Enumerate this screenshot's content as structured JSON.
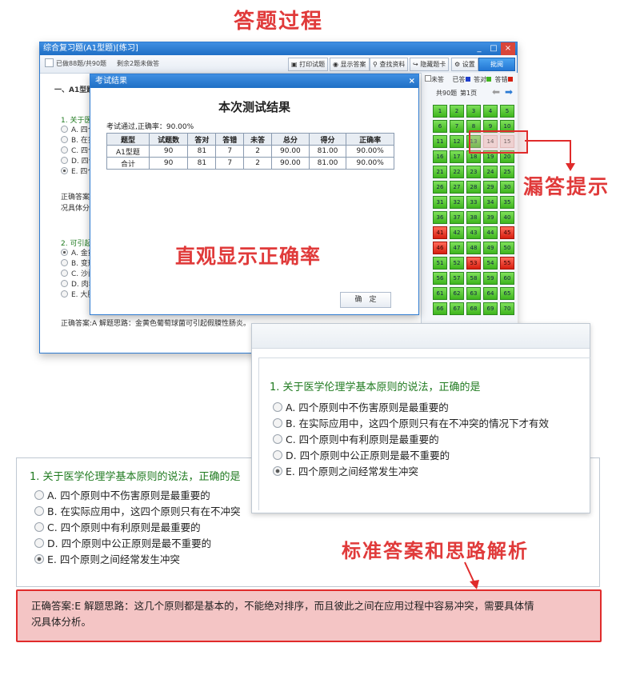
{
  "banners": {
    "top": "答题过程",
    "missed": "漏答提示",
    "accuracy": "直观显示正确率",
    "explanation": "标准答案和思路解析"
  },
  "window": {
    "title": "综合复习题(A1型题)[练习]",
    "controls": [
      "_",
      "□",
      "×"
    ],
    "status_done": "已做88题/共90题",
    "status_left": "剩余2题未做答",
    "toolbar": {
      "print": "打印试题",
      "show_answer": "显示答案",
      "lookup": "查找资料",
      "hide_card": "隐藏题卡",
      "settings": "设置",
      "submit": "批阅"
    }
  },
  "question_pane": {
    "section": "一、A1型题",
    "q1_prefix": "1. 关于医",
    "q1_opts": [
      "A. 四个",
      "B. 在实",
      "C. 四个",
      "D. 四个",
      "E. 四个"
    ],
    "q1_answer_prefix": "正确答案:E",
    "q1_analysis_prefix": "况具体分析",
    "q2_prefix": "2. 可引起",
    "q2_opts": [
      "A. 金黄",
      "B. 变形",
      "C. 沙门",
      "D. 肉毒",
      "E. 大肠"
    ],
    "q2_answer": "正确答案:A   解题思路：金黄色葡萄球菌可引起假膜性肠炎。"
  },
  "side_panel": {
    "legend": [
      "未答",
      "已答",
      "答对",
      "答错"
    ],
    "legend_colors": [
      "#ffffff",
      "#1f3fcc",
      "#3fb51e",
      "#d61f10"
    ],
    "total": "共90题",
    "page": "第1页",
    "cells": [
      {
        "n": "1",
        "s": "g"
      },
      {
        "n": "2",
        "s": "g"
      },
      {
        "n": "3",
        "s": "g"
      },
      {
        "n": "4",
        "s": "g"
      },
      {
        "n": "5",
        "s": "g"
      },
      {
        "n": "6",
        "s": "g"
      },
      {
        "n": "7",
        "s": "g"
      },
      {
        "n": "8",
        "s": "g"
      },
      {
        "n": "9",
        "s": "g"
      },
      {
        "n": "10",
        "s": "g"
      },
      {
        "n": "11",
        "s": "g"
      },
      {
        "n": "12",
        "s": "g"
      },
      {
        "n": "13",
        "s": "g"
      },
      {
        "n": "14",
        "s": "e"
      },
      {
        "n": "15",
        "s": "e"
      },
      {
        "n": "16",
        "s": "g"
      },
      {
        "n": "17",
        "s": "g"
      },
      {
        "n": "18",
        "s": "g"
      },
      {
        "n": "19",
        "s": "g"
      },
      {
        "n": "20",
        "s": "g"
      },
      {
        "n": "21",
        "s": "g"
      },
      {
        "n": "22",
        "s": "g"
      },
      {
        "n": "23",
        "s": "g"
      },
      {
        "n": "24",
        "s": "g"
      },
      {
        "n": "25",
        "s": "g"
      },
      {
        "n": "26",
        "s": "g"
      },
      {
        "n": "27",
        "s": "g"
      },
      {
        "n": "28",
        "s": "g"
      },
      {
        "n": "29",
        "s": "g"
      },
      {
        "n": "30",
        "s": "g"
      },
      {
        "n": "31",
        "s": "g"
      },
      {
        "n": "32",
        "s": "g"
      },
      {
        "n": "33",
        "s": "g"
      },
      {
        "n": "34",
        "s": "g"
      },
      {
        "n": "35",
        "s": "g"
      },
      {
        "n": "36",
        "s": "g"
      },
      {
        "n": "37",
        "s": "g"
      },
      {
        "n": "38",
        "s": "g"
      },
      {
        "n": "39",
        "s": "g"
      },
      {
        "n": "40",
        "s": "g"
      },
      {
        "n": "41",
        "s": "r"
      },
      {
        "n": "42",
        "s": "g"
      },
      {
        "n": "43",
        "s": "g"
      },
      {
        "n": "44",
        "s": "g"
      },
      {
        "n": "45",
        "s": "r"
      },
      {
        "n": "46",
        "s": "r"
      },
      {
        "n": "47",
        "s": "g"
      },
      {
        "n": "48",
        "s": "g"
      },
      {
        "n": "49",
        "s": "g"
      },
      {
        "n": "50",
        "s": "g"
      },
      {
        "n": "51",
        "s": "g"
      },
      {
        "n": "52",
        "s": "g"
      },
      {
        "n": "53",
        "s": "r"
      },
      {
        "n": "54",
        "s": "g"
      },
      {
        "n": "55",
        "s": "r"
      },
      {
        "n": "56",
        "s": "g"
      },
      {
        "n": "57",
        "s": "g"
      },
      {
        "n": "58",
        "s": "g"
      },
      {
        "n": "59",
        "s": "g"
      },
      {
        "n": "60",
        "s": "g"
      },
      {
        "n": "61",
        "s": "g"
      },
      {
        "n": "62",
        "s": "g"
      },
      {
        "n": "63",
        "s": "g"
      },
      {
        "n": "64",
        "s": "g"
      },
      {
        "n": "65",
        "s": "g"
      },
      {
        "n": "66",
        "s": "g"
      },
      {
        "n": "67",
        "s": "g"
      },
      {
        "n": "68",
        "s": "g"
      },
      {
        "n": "69",
        "s": "g"
      },
      {
        "n": "70",
        "s": "g"
      }
    ]
  },
  "dialog": {
    "title": "考试结果",
    "heading": "本次测试结果",
    "summary": "考试通过,正确率：90.00%",
    "headers": [
      "题型",
      "试题数",
      "答对",
      "答错",
      "未答",
      "总分",
      "得分",
      "正确率"
    ],
    "rows": [
      [
        "A1型题",
        "90",
        "81",
        "7",
        "2",
        "90.00",
        "81.00",
        "90.00%"
      ],
      [
        "合计",
        "90",
        "81",
        "7",
        "2",
        "90.00",
        "81.00",
        "90.00%"
      ]
    ],
    "ok": "确　定"
  },
  "zoom_right": {
    "question": "1. 关于医学伦理学基本原则的说法，正确的是",
    "options": [
      "A. 四个原则中不伤害原则是最重要的",
      "B. 在实际应用中，这四个原则只有在不冲突的情况下才有效",
      "C. 四个原则中有利原则是最重要的",
      "D. 四个原则中公正原则是最不重要的",
      "E. 四个原则之间经常发生冲突"
    ],
    "selected": 4
  },
  "zoom_left": {
    "question": "1. 关于医学伦理学基本原则的说法，正确的是",
    "options": [
      "A. 四个原则中不伤害原则是最重要的",
      "B. 在实际应用中，这四个原则只有在不冲突",
      "C. 四个原则中有利原则是最重要的",
      "D. 四个原则中公正原则是最不重要的",
      "E. 四个原则之间经常发生冲突"
    ],
    "selected": 4,
    "answer_line1": "正确答案:E   解题思路：这几个原则都是基本的，不能绝对排序，而且彼此之间在应用过程中容易冲突，需要具体情",
    "answer_line2": "况具体分析。"
  }
}
